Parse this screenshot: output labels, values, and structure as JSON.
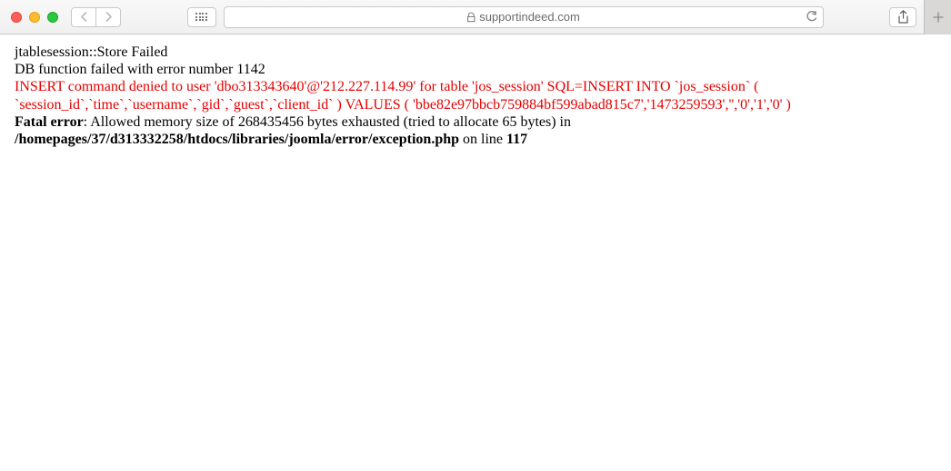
{
  "toolbar": {
    "url_domain": "supportindeed.com"
  },
  "error": {
    "line1": "jtablesession::Store Failed",
    "line2": "DB function failed with error number 1142",
    "sql": "INSERT command denied to user 'dbo313343640'@'212.227.114.99' for table 'jos_session' SQL=INSERT INTO `jos_session` ( `session_id`,`time`,`username`,`gid`,`guest`,`client_id` ) VALUES ( 'bbe82e97bbcb759884bf599abad815c7','1473259593','','0','1','0' )",
    "fatal_prefix": "Fatal error",
    "fatal_msg": ": Allowed memory size of 268435456 bytes exhausted (tried to allocate 65 bytes) in ",
    "fatal_path": "/homepages/37/d313332258/htdocs/libraries/joomla/error/exception.php",
    "fatal_online": " on line ",
    "fatal_line": "117"
  }
}
